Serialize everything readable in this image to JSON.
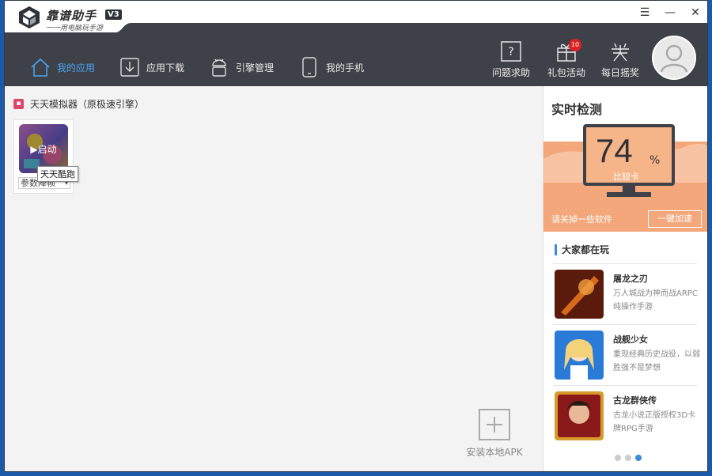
{
  "app": {
    "name": "靠谱助手",
    "version": "V3",
    "slogan": "一一用电脑玩手游"
  },
  "window_controls": {
    "menu": "☰",
    "minimize": "—",
    "close": "✕"
  },
  "nav": {
    "items": [
      {
        "label": "我的应用",
        "icon": "home-icon",
        "active": true
      },
      {
        "label": "应用下载",
        "icon": "download-icon",
        "active": false
      },
      {
        "label": "引擎管理",
        "icon": "android-icon",
        "active": false
      },
      {
        "label": "我的手机",
        "icon": "phone-icon",
        "active": false
      }
    ]
  },
  "top_actions": {
    "help": "问题求助",
    "gift": "礼包活动",
    "gift_badge": "10",
    "lottery": "每日摇奖"
  },
  "main": {
    "section_title": "天天模拟器（原极速引擎）",
    "app": {
      "name": "天天酷跑",
      "launch_label": "▶启动",
      "accel_label": "参数降帧",
      "accel_arrow": "▾"
    },
    "install_apk": "安装本地APK"
  },
  "right_panel": {
    "monitor_title": "实时检测",
    "score": "74",
    "score_unit": "%",
    "score_status": "比较卡",
    "hint": "请关掉一些软件",
    "speed_button": "一键加速",
    "popular_title": "大家都在玩",
    "games": [
      {
        "name": "屠龙之刃",
        "desc": "万人城战为神而战ARPC纯操作手游"
      },
      {
        "name": "战舰少女",
        "desc": "重现经典历史战役，以弱胜强不是梦想"
      },
      {
        "name": "古龙群侠传",
        "desc": "古龙小说正版授权3D卡牌RPG手游"
      }
    ],
    "carousel_pages": 3,
    "carousel_active": 3
  },
  "colors": {
    "navbar": "#3e4147",
    "accent": "#3a8ad8",
    "monitor_orange": "#f3a77a",
    "badge_red": "#e02020"
  }
}
